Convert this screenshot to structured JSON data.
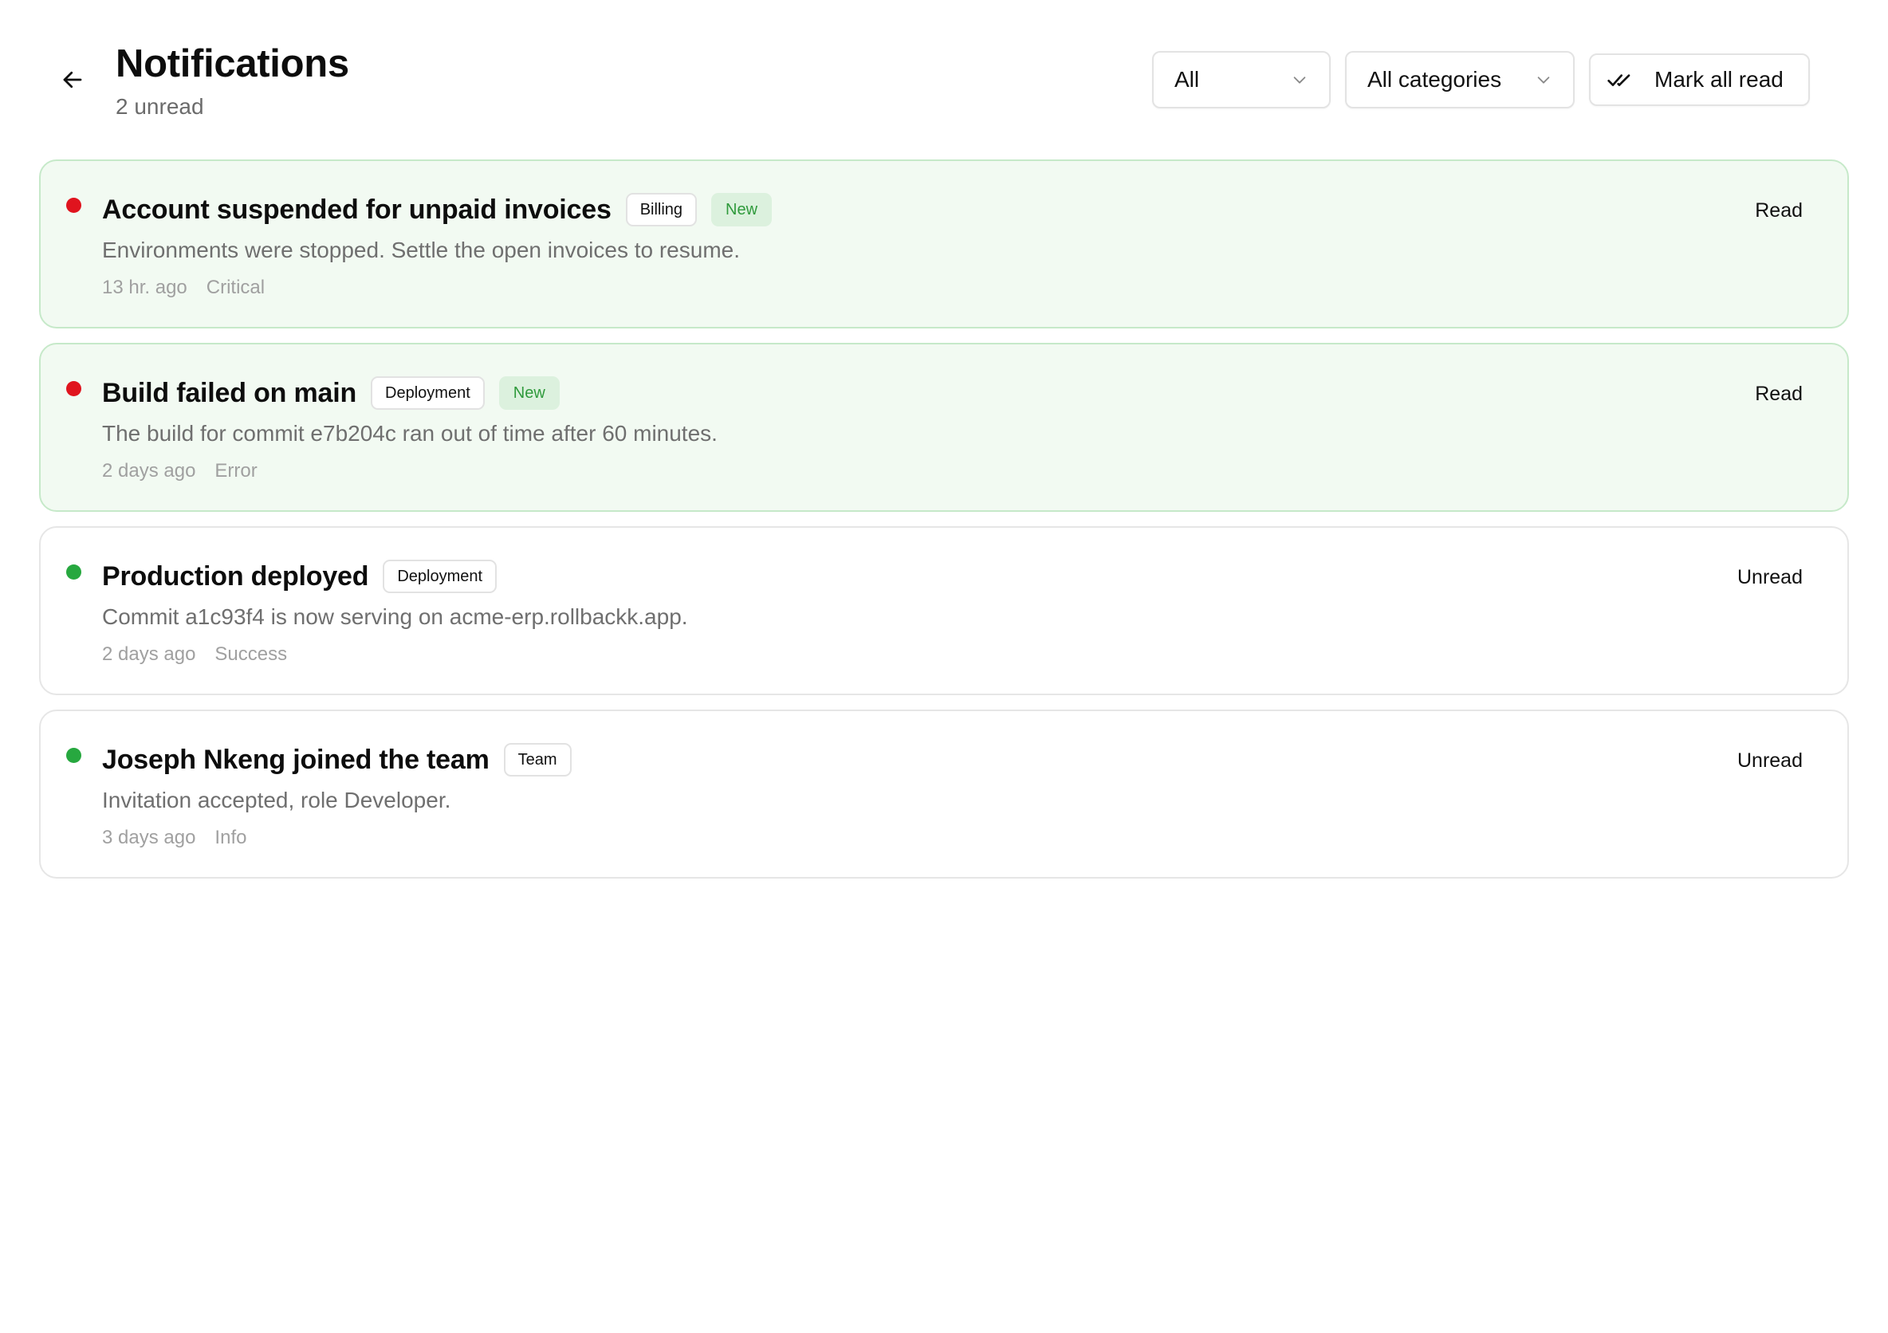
{
  "header": {
    "title": "Notifications",
    "subtitle": "2 unread",
    "back_icon": "arrow-left-icon"
  },
  "filters": {
    "status": {
      "value": "All",
      "icon": "chevron-down-icon"
    },
    "category": {
      "value": "All categories",
      "icon": "chevron-down-icon"
    },
    "mark_all": {
      "label": "Mark all read",
      "icon": "double-check-icon"
    }
  },
  "colors": {
    "unread_bg": "#f2faf2",
    "unread_border": "#c6e9c9",
    "dot_red": "#e0141e",
    "dot_green": "#27a83f",
    "new_badge_bg": "#dcf1de",
    "new_badge_text": "#2f9a3c"
  },
  "notifications": [
    {
      "title": "Account suspended for unpaid invoices",
      "tag": "Billing",
      "badge": "New",
      "body": "Environments were stopped. Settle the open invoices to resume.",
      "time": "13 hr. ago",
      "severity": "Critical",
      "action": "Read",
      "dot_color": "#e0141e",
      "unread": true
    },
    {
      "title": "Build failed on main",
      "tag": "Deployment",
      "badge": "New",
      "body": "The build for commit e7b204c ran out of time after 60 minutes.",
      "time": "2 days ago",
      "severity": "Error",
      "action": "Read",
      "dot_color": "#e0141e",
      "unread": true
    },
    {
      "title": "Production deployed",
      "tag": "Deployment",
      "badge": "",
      "body": "Commit a1c93f4 is now serving on acme-erp.rollbackk.app.",
      "time": "2 days ago",
      "severity": "Success",
      "action": "Unread",
      "dot_color": "#27a83f",
      "unread": false
    },
    {
      "title": "Joseph Nkeng joined the team",
      "tag": "Team",
      "badge": "",
      "body": "Invitation accepted, role Developer.",
      "time": "3 days ago",
      "severity": "Info",
      "action": "Unread",
      "dot_color": "#27a83f",
      "unread": false
    }
  ]
}
